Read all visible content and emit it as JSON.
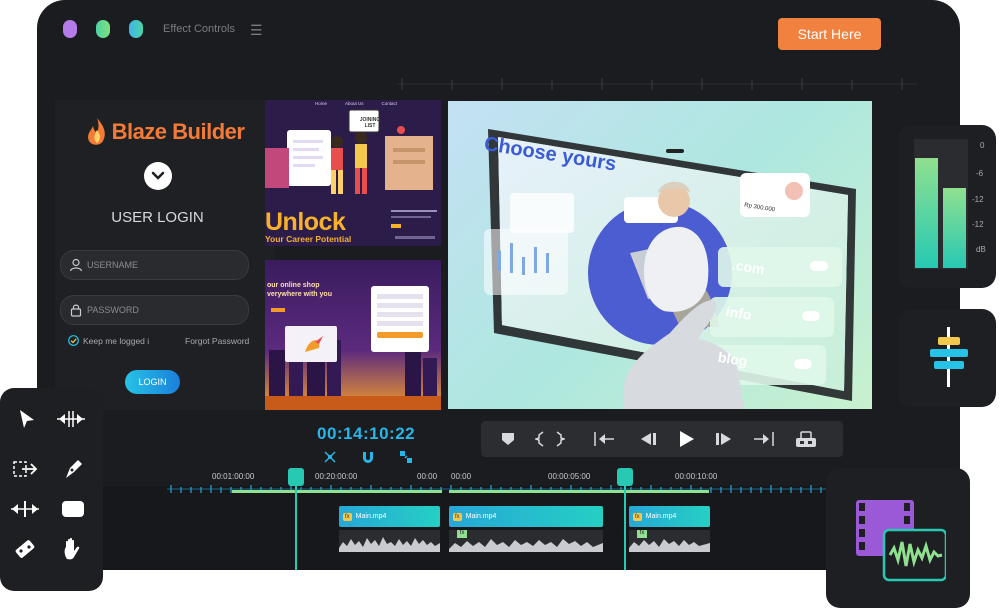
{
  "window": {
    "title": "Effect Controls",
    "dot_colors": [
      "#b57be8",
      "#4cd3a5",
      "#3fb5ec"
    ]
  },
  "header": {
    "cta_label": "Start Here"
  },
  "login": {
    "brand": "Blaze Builder",
    "heading": "USER LOGIN",
    "username_placeholder": "USERNAME",
    "password_placeholder": "PASSWORD",
    "remember_label": "Keep me logged i",
    "forgot_label": "Forgot Password",
    "button_label": "LOGIN"
  },
  "thumb1": {
    "nav": [
      "Home",
      "About Us",
      "Contact"
    ],
    "sign": "JOINING LIST",
    "headline": "Unlock",
    "subhead": "Your Career Potential"
  },
  "thumb2": {
    "headline_1": "our online shop",
    "headline_2": "verywhere with you"
  },
  "preview": {
    "headline": "Choose yours",
    "price": "Rp 300.000",
    "cards": [
      ".com",
      "info",
      "blog"
    ]
  },
  "player": {
    "timecode": "00:14:10:22",
    "transport_icons": [
      "marker-icon",
      "brackets-icon",
      "go-start-icon",
      "step-back-icon",
      "play-icon",
      "step-forward-icon",
      "go-end-icon",
      "export-frame-icon"
    ]
  },
  "timeline": {
    "ruler_labels": [
      "00:01:00:00",
      "00:20:00:00",
      "00:00",
      "00:00",
      "00:00:05:00",
      "00:00:10:00"
    ],
    "clips": [
      {
        "label": "Main.mp4"
      },
      {
        "label": "Main.mp4"
      },
      {
        "label": "Main.mp4"
      }
    ]
  },
  "meter": {
    "labels": [
      "0",
      "-6",
      "-12",
      "-12",
      "dB"
    ],
    "levels": [
      0.85,
      0.62
    ]
  },
  "tools": [
    "select-icon",
    "ripple-edit-icon",
    "track-select-icon",
    "pen-icon",
    "slip-icon",
    "rectangle-icon",
    "razor-icon",
    "hand-icon"
  ]
}
